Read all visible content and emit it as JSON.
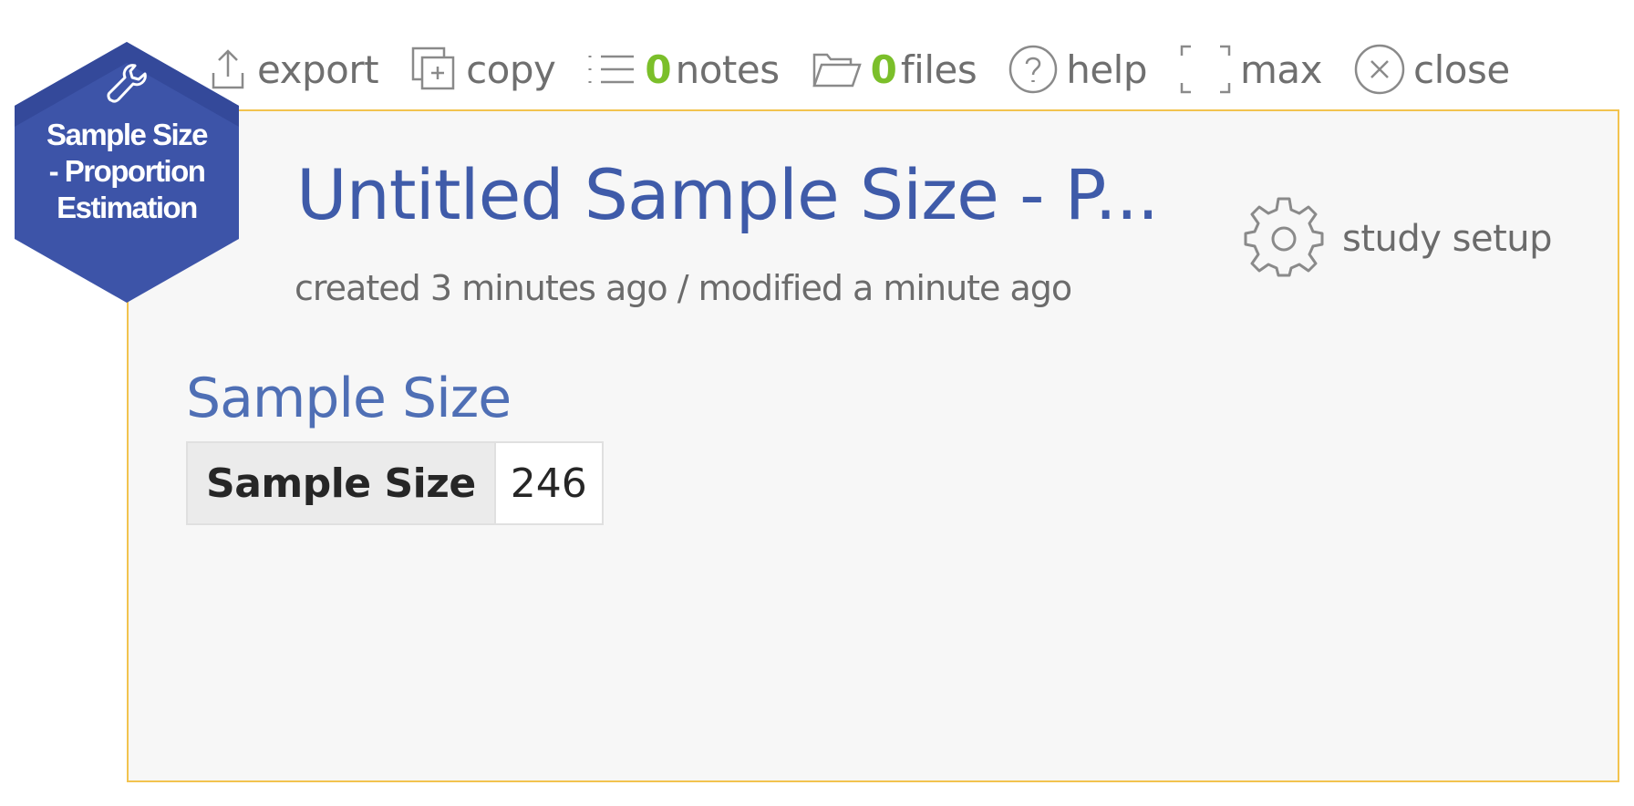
{
  "toolbar": {
    "export_label": "export",
    "copy_label": "copy",
    "notes_count": "0",
    "notes_label": "notes",
    "files_count": "0",
    "files_label": "files",
    "help_label": "help",
    "max_label": "max",
    "close_label": "close"
  },
  "badge": {
    "line1": "Sample Size",
    "line2": "- Proportion",
    "line3": "Estimation",
    "icon": "wrench-icon",
    "color": "#3d54a8"
  },
  "study": {
    "title": "Untitled Sample Size - P...",
    "meta": "created 3 minutes ago / modified a minute ago",
    "setup_label": "study setup"
  },
  "results": {
    "heading": "Sample Size",
    "rows": [
      {
        "label": "Sample Size",
        "value": "246"
      }
    ]
  },
  "colors": {
    "accent": "#3f5ba9",
    "count": "#7bbf2a",
    "panel_border": "#f2c34f",
    "panel_bg": "#f7f7f7"
  }
}
